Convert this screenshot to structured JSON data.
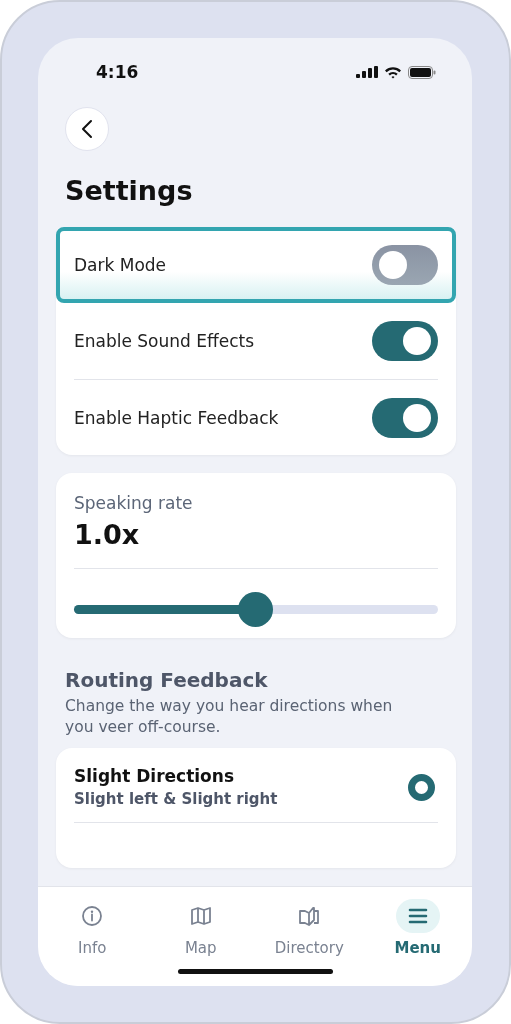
{
  "status_bar": {
    "time": "4:16"
  },
  "title": "Settings",
  "toggles": [
    {
      "label": "Dark Mode",
      "on": false,
      "highlighted": true
    },
    {
      "label": "Enable Sound Effects",
      "on": true,
      "highlighted": false
    },
    {
      "label": "Enable Haptic Feedback",
      "on": true,
      "highlighted": false
    }
  ],
  "speaking_rate": {
    "label": "Speaking rate",
    "value": "1.0x",
    "level": 0.5
  },
  "routing_feedback": {
    "title": "Routing Feedback",
    "description": "Change the way you hear directions when you veer off-course.",
    "options": [
      {
        "title": "Slight Directions",
        "subtitle": "Slight left & Slight right",
        "selected": true
      }
    ]
  },
  "nav": [
    {
      "label": "Info",
      "kind": "info",
      "selected": false
    },
    {
      "label": "Map",
      "kind": "map",
      "selected": false
    },
    {
      "label": "Directory",
      "kind": "book",
      "selected": false
    },
    {
      "label": "Menu",
      "kind": "menu",
      "selected": true
    }
  ]
}
